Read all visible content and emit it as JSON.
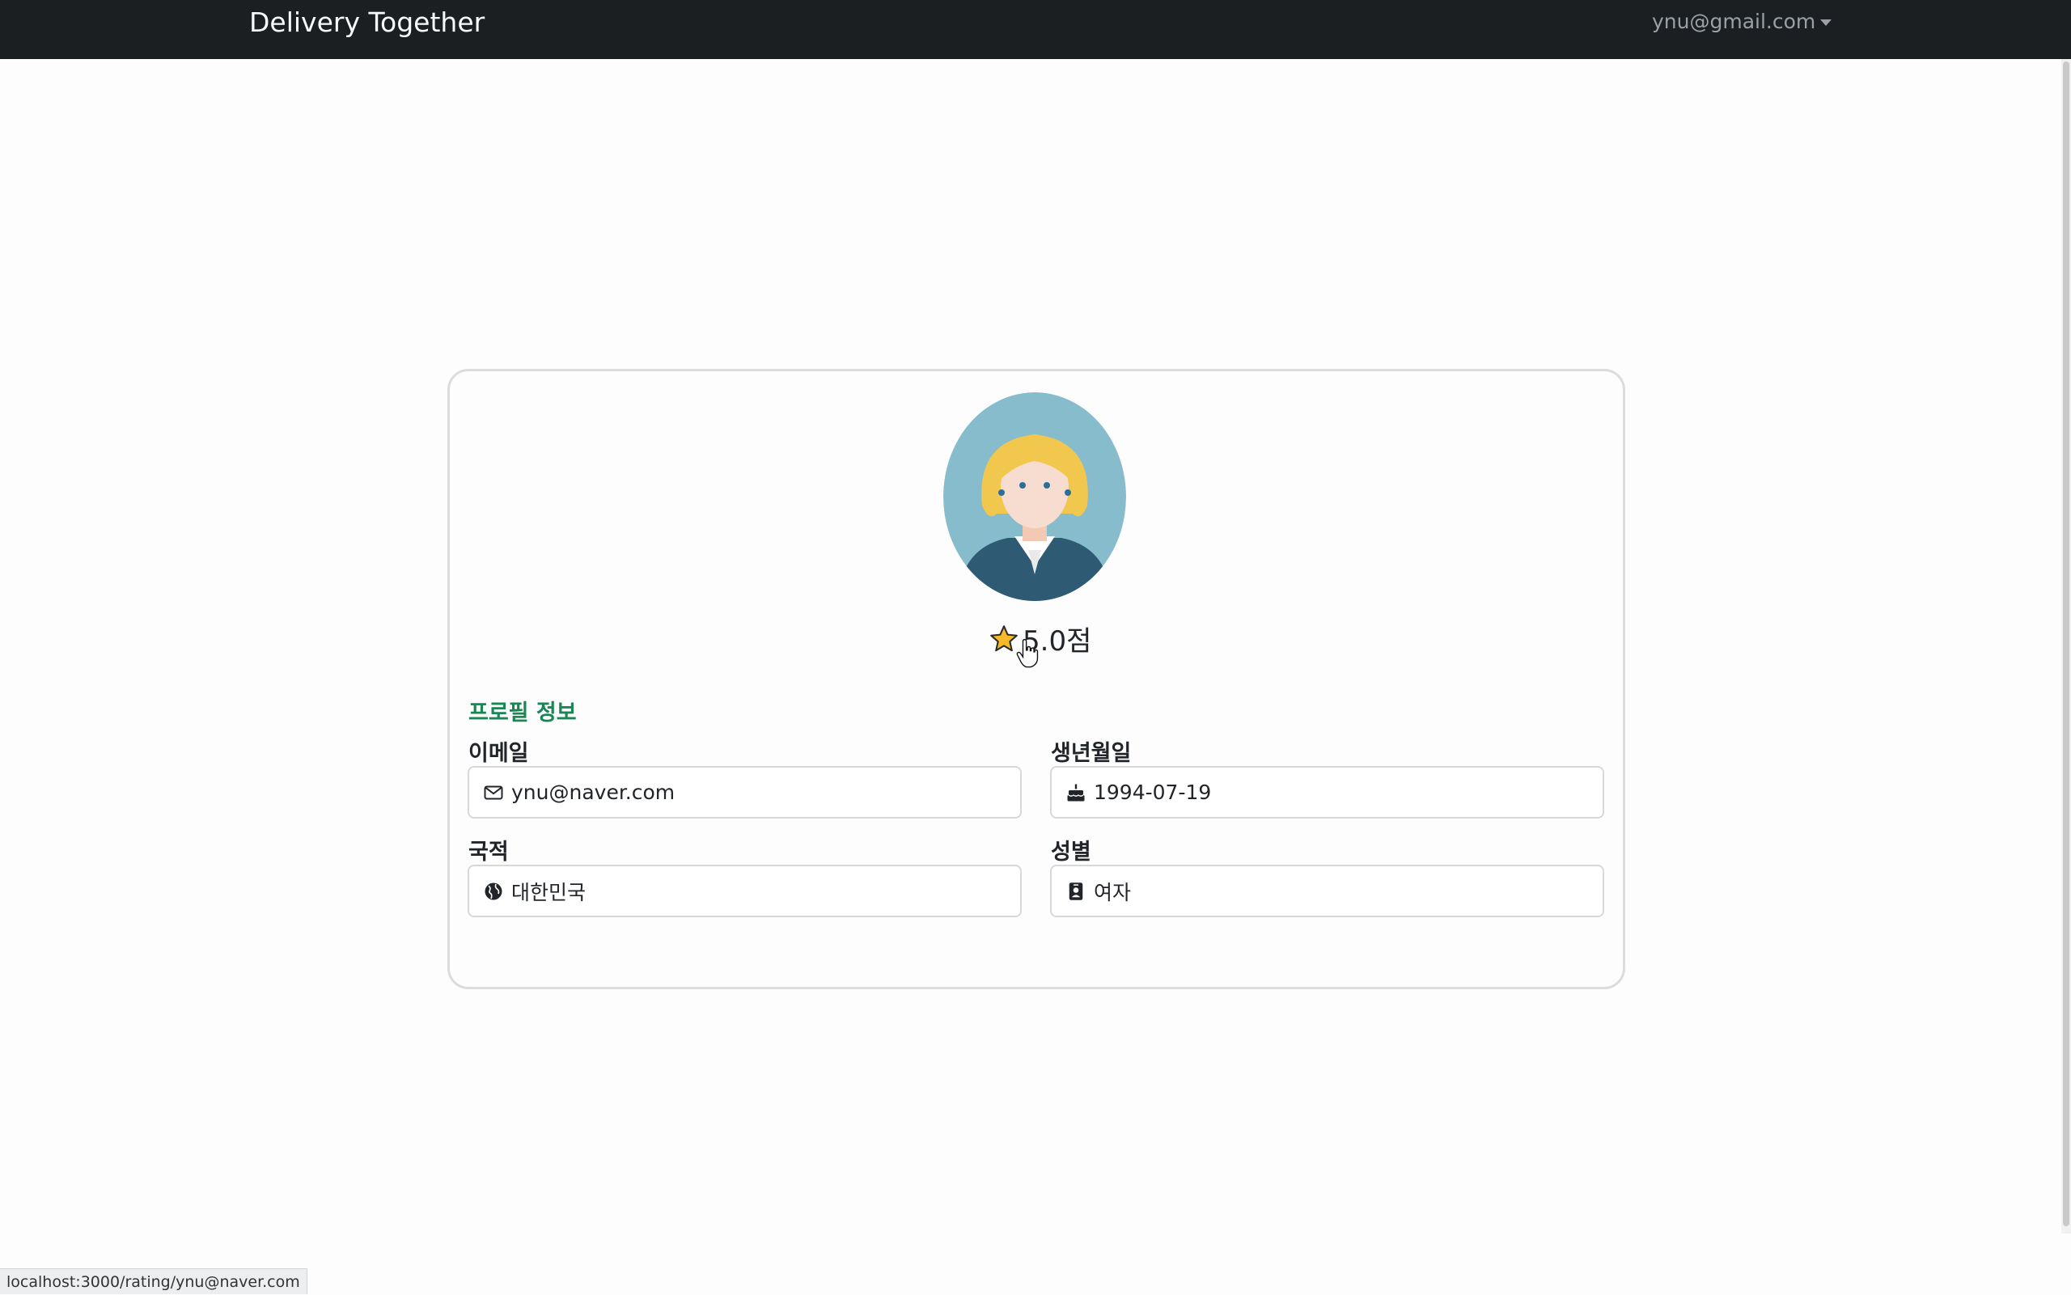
{
  "navbar": {
    "brand": "Delivery Together",
    "user_email": "ynu@gmail.com"
  },
  "profile": {
    "avatar_icon": "woman-avatar",
    "rating_icon": "star-icon",
    "rating_text": "5.0점",
    "section_title": "프로필 정보",
    "fields": {
      "email": {
        "label": "이메일",
        "value": "ynu@naver.com",
        "icon": "envelope-icon"
      },
      "birthday": {
        "label": "생년월일",
        "value": "1994-07-19",
        "icon": "cake-icon"
      },
      "nationality": {
        "label": "국적",
        "value": "대한민국",
        "icon": "globe-icon"
      },
      "gender": {
        "label": "성별",
        "value": "여자",
        "icon": "person-badge-icon"
      }
    }
  },
  "status_bar": {
    "url": "localhost:3000/rating/ynu@naver.com"
  },
  "colors": {
    "navbar_bg": "#1b1f22",
    "section_title": "#198754",
    "avatar_bg": "#86bccb",
    "star": "#f5b92a"
  }
}
